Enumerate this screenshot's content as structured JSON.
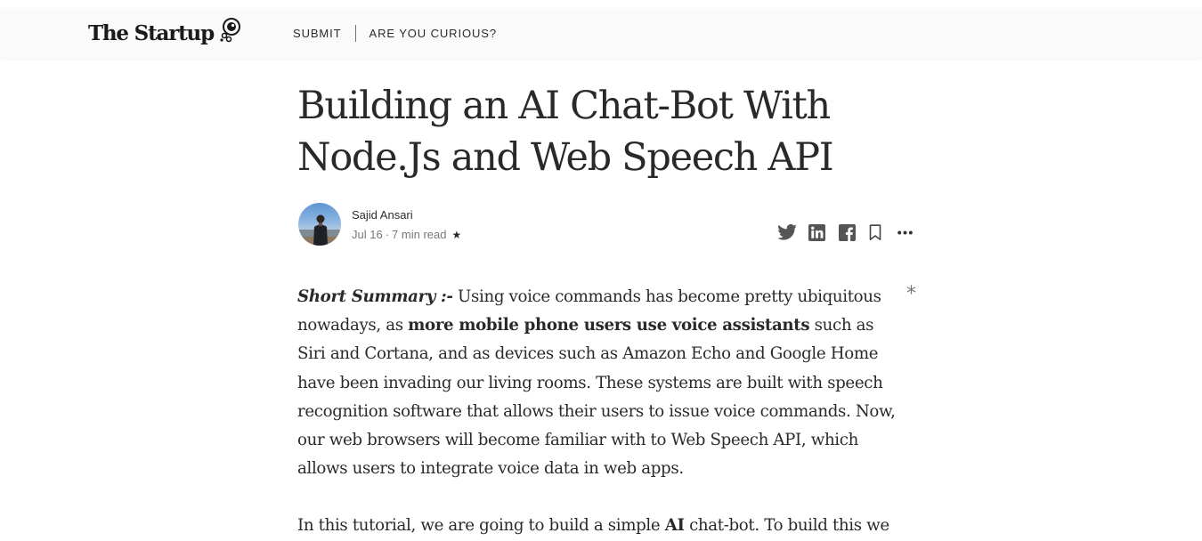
{
  "header": {
    "logo_text": "The Startup",
    "nav": [
      {
        "label": "SUBMIT"
      },
      {
        "label": "ARE YOU CURIOUS?"
      }
    ]
  },
  "article": {
    "title_line1": "Building an AI Chat-Bot With",
    "title_line2": "Node.Js and Web Speech API",
    "author": "Sajid Ansari",
    "date": "Jul 16",
    "separator": "·",
    "read_time": "7 min read",
    "member_star": "★",
    "side_asterisk": "*",
    "p1": {
      "lead": "Short Summary :-",
      "t1": " Using voice commands has become pretty ubiquitous nowadays, as ",
      "bold": "more mobile phone users use voice assistants",
      "t2": " such as Siri and Cortana, and as devices such as Amazon Echo and Google Home have been invading our living rooms. These systems are built with speech recognition software that allows their users to issue voice commands. Now, our web browsers will become familiar with to Web Speech API, which allows users to integrate voice data in web apps."
    },
    "p2": {
      "t1": "In this tutorial, we are going to build a simple ",
      "bold": "AI",
      "t2": " chat-bot. To build this we"
    }
  },
  "share_icons": [
    "twitter-icon",
    "linkedin-icon",
    "facebook-icon",
    "bookmark-icon",
    "more-icon"
  ],
  "colors": {
    "header_bg": "#fafafa",
    "text": "rgba(0,0,0,0.84)",
    "meta": "rgba(0,0,0,0.54)",
    "icon": "#555555"
  }
}
